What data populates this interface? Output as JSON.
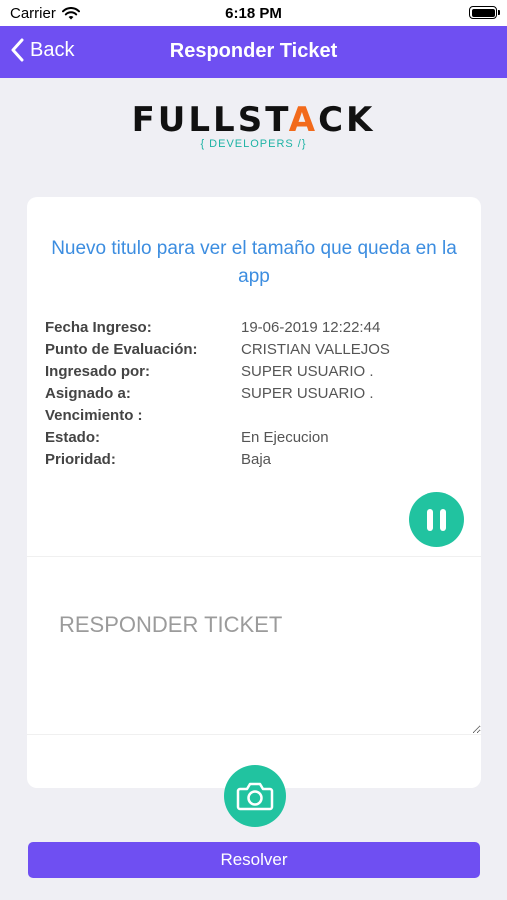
{
  "status_bar": {
    "carrier": "Carrier",
    "time": "6:18 PM"
  },
  "nav": {
    "back_label": "Back",
    "title": "Responder Ticket"
  },
  "logo": {
    "main_start": "FULLST",
    "main_accent": "A",
    "main_end": "CK",
    "sub": "{ DEVELOPERS /}"
  },
  "ticket": {
    "title": "Nuevo titulo para ver el tamaño que queda en la app",
    "fields": [
      {
        "label": "Fecha Ingreso:",
        "value": "19-06-2019 12:22:44"
      },
      {
        "label": "Punto de Evaluación:",
        "value": "CRISTIAN VALLEJOS"
      },
      {
        "label": "Ingresado por:",
        "value": "SUPER USUARIO ."
      },
      {
        "label": "Asignado a:",
        "value": "SUPER USUARIO ."
      },
      {
        "label": "Vencimiento :",
        "value": ""
      },
      {
        "label": "Estado:",
        "value": "En Ejecucion"
      },
      {
        "label": "Prioridad:",
        "value": "Baja"
      }
    ]
  },
  "reply": {
    "placeholder": "RESPONDER TICKET",
    "value": ""
  },
  "actions": {
    "resolve_label": "Resolver"
  },
  "icons": {
    "pause": "pause-icon",
    "camera": "camera-icon",
    "back": "chevron-left-icon",
    "wifi": "wifi-icon",
    "battery": "battery-icon"
  },
  "colors": {
    "primary": "#6f4ff2",
    "accent": "#21c3a0",
    "title_blue": "#3c8de0",
    "logo_orange": "#f26a1b"
  }
}
